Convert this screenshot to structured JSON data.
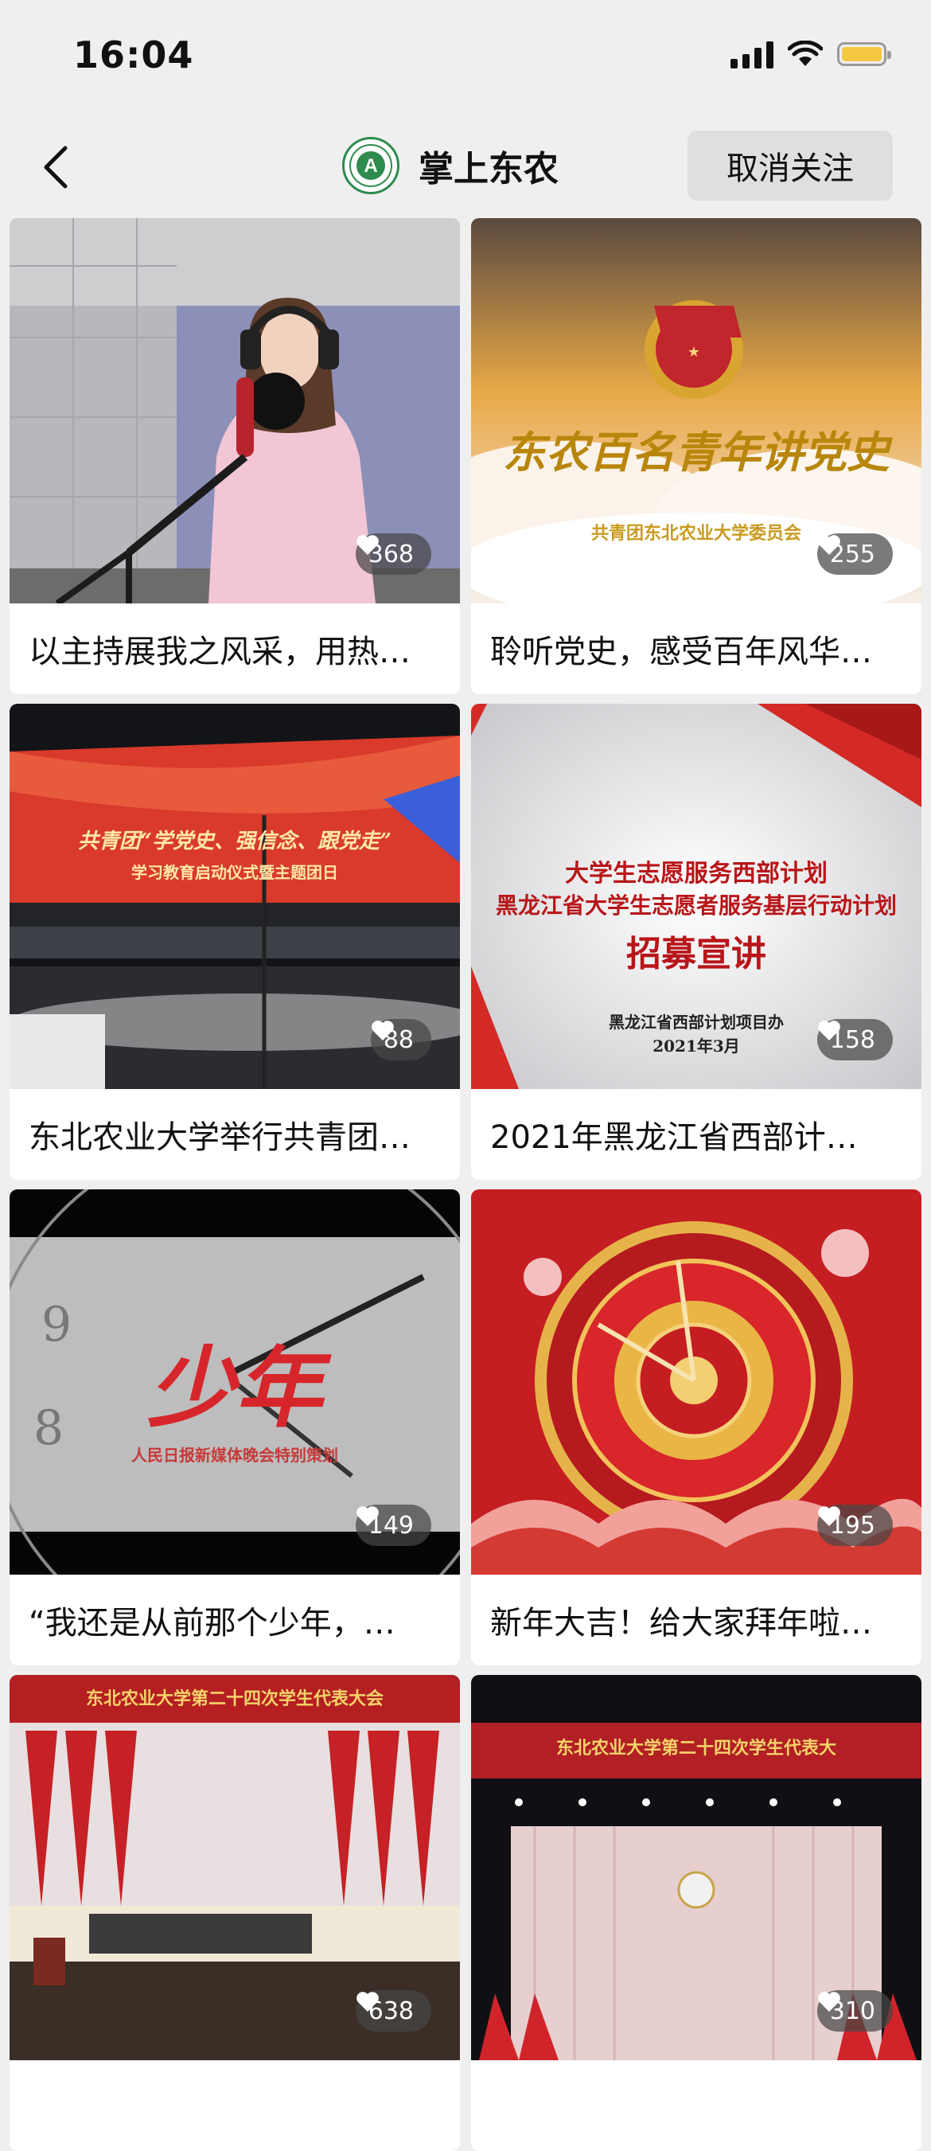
{
  "status_bar": {
    "time": "16:04",
    "battery_color": "#f5c842"
  },
  "nav": {
    "back_icon": "chevron-left-icon",
    "title": "掌上东农",
    "logo_letter": "A",
    "unfollow_label": "取消关注"
  },
  "thumbnails": {
    "party_history_banner": "东农百名青年讲党史",
    "party_history_sub": "共青团东北农业大学委员会",
    "ceremony_title": "共青团“学党史、强信念、跟党走”",
    "ceremony_sub": "学习教育启动仪式暨主题团日",
    "volunteer_line1": "大学生志愿服务西部计划",
    "volunteer_line2": "黑龙江省大学生志愿者服务基层行动计划",
    "volunteer_line3": "招募宣讲",
    "volunteer_org": "黑龙江省西部计划项目办",
    "volunteer_date": "2021年3月",
    "youth_title": "少年",
    "youth_sub": "人民日报新媒体晚会特别策划",
    "congress_banner_a": "东北农业大学第二十四次学生代表大会",
    "congress_banner_b": "东北农业大学第二十四次学生代表大"
  },
  "videos": [
    {
      "title": "以主持展我之风采，用热…",
      "likes": "368",
      "thumb": "singer"
    },
    {
      "title": "聆听党史，感受百年风华…",
      "likes": "255",
      "thumb": "clouds"
    },
    {
      "title": "东北农业大学举行共青团…",
      "likes": "88",
      "thumb": "stage"
    },
    {
      "title": "2021年黑龙江省西部计…",
      "likes": "158",
      "thumb": "volunteer"
    },
    {
      "title": "“我还是从前那个少年，…",
      "likes": "149",
      "thumb": "youth"
    },
    {
      "title": "新年大吉！给大家拜年啦…",
      "likes": "195",
      "thumb": "newyear"
    },
    {
      "title": "",
      "likes": "638",
      "thumb": "congress1"
    },
    {
      "title": "",
      "likes": "310",
      "thumb": "congress2"
    }
  ]
}
